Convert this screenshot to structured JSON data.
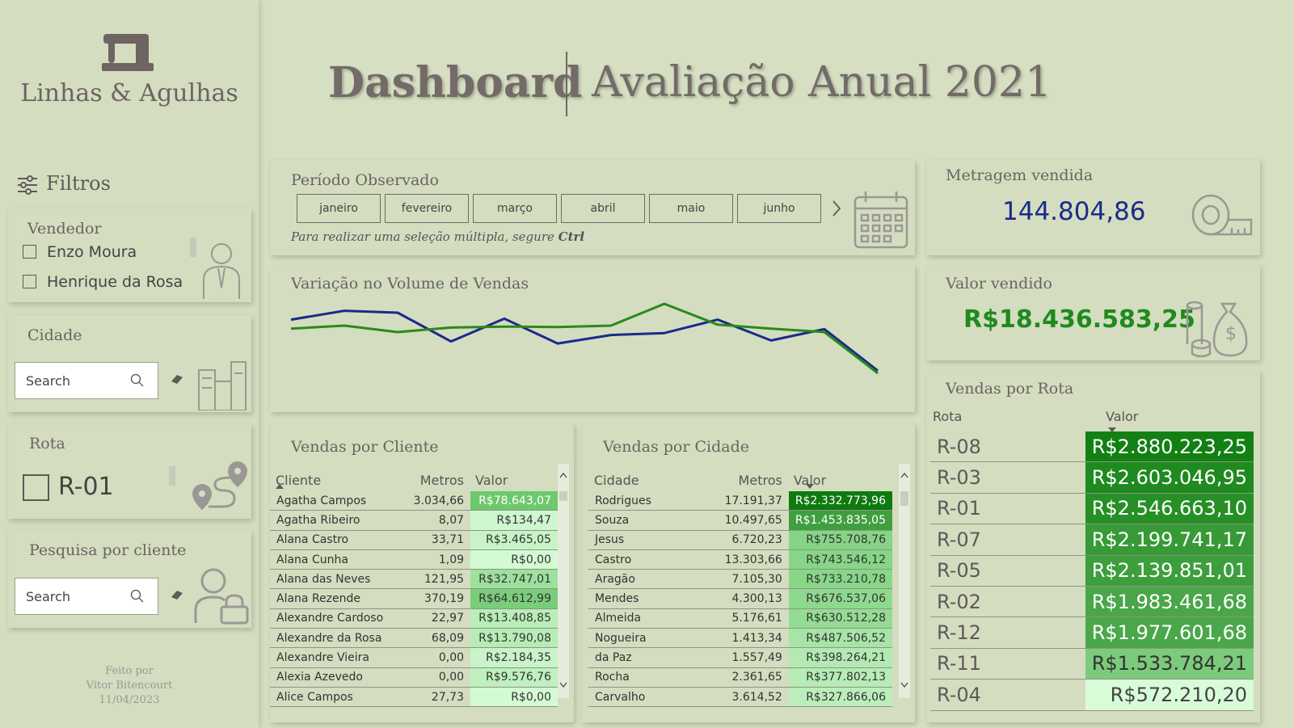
{
  "brand": {
    "name": "Linhas & Agulhas"
  },
  "header": {
    "title": "Dashboard",
    "subtitle": "Avaliação Anual 2021"
  },
  "filters": {
    "heading": "Filtros",
    "vendedor": {
      "title": "Vendedor",
      "options": [
        "Enzo Moura",
        "Henrique da Rosa"
      ]
    },
    "cidade": {
      "title": "Cidade",
      "placeholder": "Search"
    },
    "rota": {
      "title": "Rota",
      "options": [
        "R-01"
      ]
    },
    "cliente": {
      "title": "Pesquisa por cliente",
      "placeholder": "Search"
    }
  },
  "credit": {
    "line1": "Feito por",
    "line2": "Vitor Bitencourt",
    "line3": "11/04/2023"
  },
  "periodo": {
    "title": "Período Observado",
    "months": [
      "janeiro",
      "fevereiro",
      "março",
      "abril",
      "maio",
      "junho"
    ],
    "hint_prefix": "Para realizar uma seleção múltipla, segure ",
    "hint_key": "Ctrl"
  },
  "metragem": {
    "title": "Metragem vendida",
    "value": "144.804,86"
  },
  "valor": {
    "title": "Valor vendido",
    "value": "R$18.436.583,25"
  },
  "volume": {
    "title": "Variação no Volume de Vendas"
  },
  "chart_data": {
    "type": "line",
    "title": "Variação no Volume de Vendas",
    "x": [
      1,
      2,
      3,
      4,
      5,
      6,
      7,
      8,
      9,
      10,
      11,
      12
    ],
    "series": [
      {
        "color": "#1a2a8c",
        "values": [
          0.68,
          0.86,
          0.82,
          0.24,
          0.7,
          0.2,
          0.37,
          0.41,
          0.68,
          0.26,
          0.49,
          -0.35
        ]
      },
      {
        "color": "#2a8a1a",
        "values": [
          0.5,
          0.56,
          0.43,
          0.52,
          0.54,
          0.53,
          0.56,
          1.0,
          0.58,
          0.5,
          0.43,
          -0.4
        ]
      }
    ]
  },
  "clientes": {
    "title": "Vendas por Cliente",
    "columns": [
      "Cliente",
      "Metros",
      "Valor"
    ],
    "rows": [
      [
        "Agatha Campos",
        "3.034,66",
        "R$78.643,07"
      ],
      [
        "Agatha Ribeiro",
        "8,07",
        "R$134,47"
      ],
      [
        "Alana Castro",
        "33,71",
        "R$3.465,05"
      ],
      [
        "Alana Cunha",
        "1,09",
        "R$0,00"
      ],
      [
        "Alana das Neves",
        "121,95",
        "R$32.747,01"
      ],
      [
        "Alana Rezende",
        "370,19",
        "R$64.612,99"
      ],
      [
        "Alexandre Cardoso",
        "22,97",
        "R$13.408,85"
      ],
      [
        "Alexandre da Rosa",
        "68,09",
        "R$13.790,08"
      ],
      [
        "Alexandre Vieira",
        "0,00",
        "R$2.184,35"
      ],
      [
        "Alexia Azevedo",
        "0,00",
        "R$9.576,76"
      ],
      [
        "Alice Campos",
        "27,73",
        "R$0,00"
      ]
    ],
    "shades": [
      "#6ec86e",
      "#cff7cf",
      "#c7f3c7",
      "#d4fad4",
      "#9ee09e",
      "#7acd7a",
      "#b8eeb8",
      "#b6edb6",
      "#c9f4c9",
      "#bff0bf",
      "#d4fad4"
    ]
  },
  "cidades": {
    "title": "Vendas por Cidade",
    "columns": [
      "Cidade",
      "Metros",
      "Valor"
    ],
    "rows": [
      [
        "Rodrigues",
        "17.191,37",
        "R$2.332.773,96"
      ],
      [
        "Souza",
        "10.497,65",
        "R$1.453.835,05"
      ],
      [
        "Jesus",
        "6.720,23",
        "R$755.708,76"
      ],
      [
        "Castro",
        "13.303,66",
        "R$743.546,12"
      ],
      [
        "Aragão",
        "7.105,30",
        "R$733.210,78"
      ],
      [
        "Mendes",
        "4.300,13",
        "R$676.537,06"
      ],
      [
        "Almeida",
        "5.176,61",
        "R$630.512,28"
      ],
      [
        "Nogueira",
        "1.413,34",
        "R$487.506,52"
      ],
      [
        "da Paz",
        "1.557,49",
        "R$398.264,21"
      ],
      [
        "Rocha",
        "2.361,65",
        "R$377.802,13"
      ],
      [
        "Carvalho",
        "3.614,52",
        "R$327.866,06"
      ]
    ],
    "shades": [
      "#0f7a0f",
      "#3f9f3f",
      "#86d486",
      "#87d587",
      "#89d689",
      "#8fd98f",
      "#94dc94",
      "#a7e4a7",
      "#b3eab3",
      "#b6ecb6",
      "#bbeebb"
    ]
  },
  "rotas": {
    "title": "Vendas por Rota",
    "columns": [
      "Rota",
      "Valor"
    ],
    "rows": [
      [
        "R-08",
        "R$2.880.223,25"
      ],
      [
        "R-03",
        "R$2.603.046,95"
      ],
      [
        "R-01",
        "R$2.546.663,10"
      ],
      [
        "R-07",
        "R$2.199.741,17"
      ],
      [
        "R-05",
        "R$2.139.851,01"
      ],
      [
        "R-02",
        "R$1.983.461,68"
      ],
      [
        "R-12",
        "R$1.977.601,68"
      ],
      [
        "R-11",
        "R$1.533.784,21"
      ],
      [
        "R-04",
        "R$572.210,20"
      ]
    ],
    "shades": [
      "#138013",
      "#1f8a1f",
      "#268f26",
      "#379a37",
      "#3d9e3d",
      "#49a649",
      "#4aa74a",
      "#7ccb7c",
      "#d8fcd8"
    ]
  }
}
